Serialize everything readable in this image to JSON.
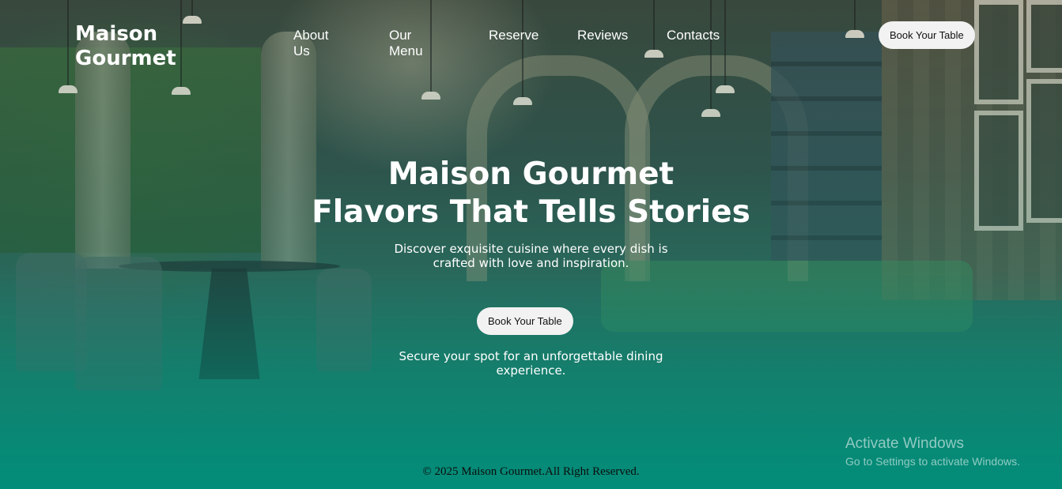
{
  "brand": {
    "name_line1": "Maison",
    "name_line2": "Gourmet"
  },
  "nav": {
    "items": [
      {
        "label": "About Us"
      },
      {
        "label": "Our Menu"
      },
      {
        "label": "Reserve"
      },
      {
        "label": "Reviews"
      },
      {
        "label": "Contacts"
      }
    ],
    "cta_label": "Book Your Table"
  },
  "hero": {
    "title_line1": "Maison Gourmet",
    "title_line2": "Flavors That Tells Stories",
    "subtitle_line1": "Discover exquisite cuisine where every dish is",
    "subtitle_line2": "crafted with love and inspiration.",
    "cta_label": "Book Your Table",
    "note_line1": "Secure your spot for an unforgettable dining",
    "note_line2": "experience."
  },
  "footer": {
    "copyright": "© 2025 Maison Gourmet.All Right Reserved."
  },
  "watermark": {
    "title": "Activate Windows",
    "subtitle": "Go to Settings to activate Windows."
  },
  "colors": {
    "text": "#ffffff",
    "button_bg": "#f2f2f2",
    "gradient_bottom": "#11907e"
  }
}
